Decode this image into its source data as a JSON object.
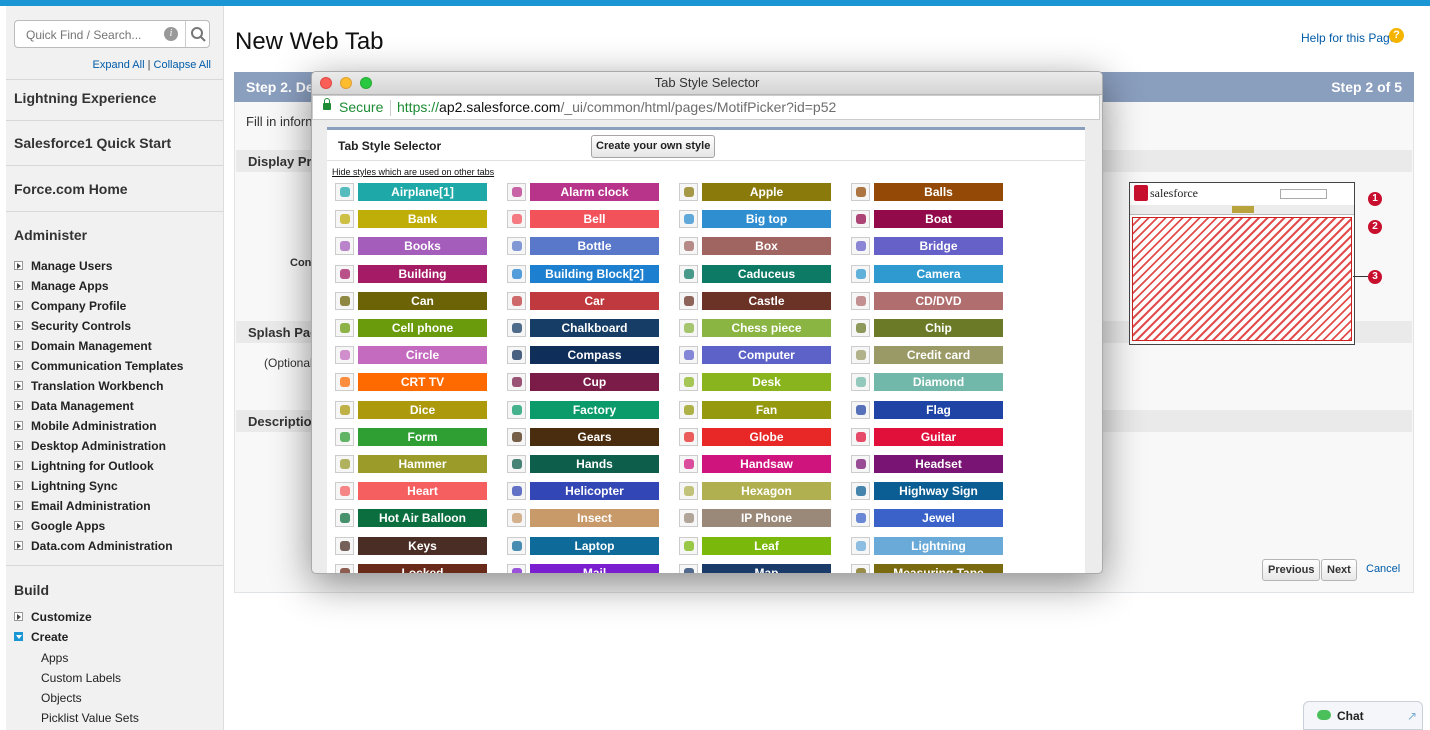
{
  "sidebar": {
    "search_placeholder": "Quick Find / Search...",
    "info_icon_text": "i",
    "expand_all": "Expand All",
    "separator": "|",
    "collapse_all": "Collapse All",
    "lightning_experience": "Lightning Experience",
    "salesforce1": "Salesforce1 Quick Start",
    "force_home": "Force.com Home",
    "administer": "Administer",
    "admin_items": [
      "Manage Users",
      "Manage Apps",
      "Company Profile",
      "Security Controls",
      "Domain Management",
      "Communication Templates",
      "Translation Workbench",
      "Data Management",
      "Mobile Administration",
      "Desktop Administration",
      "Lightning for Outlook",
      "Lightning Sync",
      "Email Administration",
      "Google Apps",
      "Data.com Administration"
    ],
    "build": "Build",
    "customize": "Customize",
    "create": "Create",
    "create_items": [
      "Apps",
      "Custom Labels",
      "Objects",
      "Picklist Value Sets"
    ]
  },
  "main": {
    "title": "New Web Tab",
    "help_link": "Help for this Page",
    "step_left": "Step 2. De",
    "step_right": "Step 2 of 5",
    "fill_in": "Fill in inforn",
    "display_props": "Display Pr",
    "con_label": "Con",
    "splash_page": "Splash Pag",
    "optional": "(Optional",
    "description": "Descriptio",
    "callouts": [
      "1",
      "2",
      "3"
    ],
    "preview_logo": "salesforce",
    "buttons": {
      "previous": "Previous",
      "next": "Next",
      "cancel": "Cancel"
    }
  },
  "chat": {
    "label": "Chat"
  },
  "dialog": {
    "window_title": "Tab Style Selector",
    "secure_label": "Secure",
    "url_scheme": "https://",
    "url_domain": "ap2.salesforce.com",
    "url_path": "/_ui/common/html/pages/MotifPicker?id=p52",
    "heading": "Tab Style Selector",
    "create_button": "Create your own style",
    "hide_link": "Hide styles which are used on other tabs",
    "styles": [
      {
        "name": "Airplane[1]",
        "color": "#1ea8a8"
      },
      {
        "name": "Alarm clock",
        "color": "#b8338a"
      },
      {
        "name": "Apple",
        "color": "#8a7a0c"
      },
      {
        "name": "Balls",
        "color": "#944a06"
      },
      {
        "name": "Bank",
        "color": "#bfae08"
      },
      {
        "name": "Bell",
        "color": "#f2525a"
      },
      {
        "name": "Big top",
        "color": "#2e8ecf"
      },
      {
        "name": "Boat",
        "color": "#930a4a"
      },
      {
        "name": "Books",
        "color": "#a45dbb"
      },
      {
        "name": "Bottle",
        "color": "#5a78c9"
      },
      {
        "name": "Box",
        "color": "#a06560"
      },
      {
        "name": "Bridge",
        "color": "#6660c9"
      },
      {
        "name": "Building",
        "color": "#a61b66"
      },
      {
        "name": "Building Block[2]",
        "color": "#1c7fd0"
      },
      {
        "name": "Caduceus",
        "color": "#0d7a66"
      },
      {
        "name": "Camera",
        "color": "#2e9ad0"
      },
      {
        "name": "Can",
        "color": "#6b6306"
      },
      {
        "name": "Car",
        "color": "#c0393e"
      },
      {
        "name": "Castle",
        "color": "#6b3226"
      },
      {
        "name": "CD/DVD",
        "color": "#b06e6e"
      },
      {
        "name": "Cell phone",
        "color": "#6a9b0c"
      },
      {
        "name": "Chalkboard",
        "color": "#163d66"
      },
      {
        "name": "Chess piece",
        "color": "#8ab542"
      },
      {
        "name": "Chip",
        "color": "#6a7a26"
      },
      {
        "name": "Circle",
        "color": "#c46bbf"
      },
      {
        "name": "Compass",
        "color": "#0f2e5a"
      },
      {
        "name": "Computer",
        "color": "#5d62c9"
      },
      {
        "name": "Credit card",
        "color": "#9a9a66"
      },
      {
        "name": "CRT TV",
        "color": "#ff6a00"
      },
      {
        "name": "Cup",
        "color": "#7b1c48"
      },
      {
        "name": "Desk",
        "color": "#8ab41e"
      },
      {
        "name": "Diamond",
        "color": "#72b8aa"
      },
      {
        "name": "Dice",
        "color": "#ad9a0c"
      },
      {
        "name": "Factory",
        "color": "#0b9a6a"
      },
      {
        "name": "Fan",
        "color": "#94990e"
      },
      {
        "name": "Flag",
        "color": "#2044a5"
      },
      {
        "name": "Form",
        "color": "#2f9e33"
      },
      {
        "name": "Gears",
        "color": "#4a2c0f"
      },
      {
        "name": "Globe",
        "color": "#e82727"
      },
      {
        "name": "Guitar",
        "color": "#e0103a"
      },
      {
        "name": "Hammer",
        "color": "#9a9b29"
      },
      {
        "name": "Hands",
        "color": "#0d5e4a"
      },
      {
        "name": "Handsaw",
        "color": "#d0147e"
      },
      {
        "name": "Headset",
        "color": "#7a1474"
      },
      {
        "name": "Heart",
        "color": "#f55f5f"
      },
      {
        "name": "Helicopter",
        "color": "#3346b5"
      },
      {
        "name": "Hexagon",
        "color": "#b0b050"
      },
      {
        "name": "Highway Sign",
        "color": "#0a5e93"
      },
      {
        "name": "Hot Air Balloon",
        "color": "#0b6e3e"
      },
      {
        "name": "Insect",
        "color": "#c89a6a"
      },
      {
        "name": "IP Phone",
        "color": "#9a8878"
      },
      {
        "name": "Jewel",
        "color": "#3a62c9"
      },
      {
        "name": "Keys",
        "color": "#4a2e26"
      },
      {
        "name": "Laptop",
        "color": "#0e6a99"
      },
      {
        "name": "Leaf",
        "color": "#7ab80c"
      },
      {
        "name": "Lightning",
        "color": "#6aaad8"
      },
      {
        "name": "Locked",
        "color": "#6a2a1a"
      },
      {
        "name": "Mail",
        "color": "#7a1ed0"
      },
      {
        "name": "Map",
        "color": "#1a3a6a"
      },
      {
        "name": "Measuring Tape",
        "color": "#7a6a10"
      }
    ]
  }
}
